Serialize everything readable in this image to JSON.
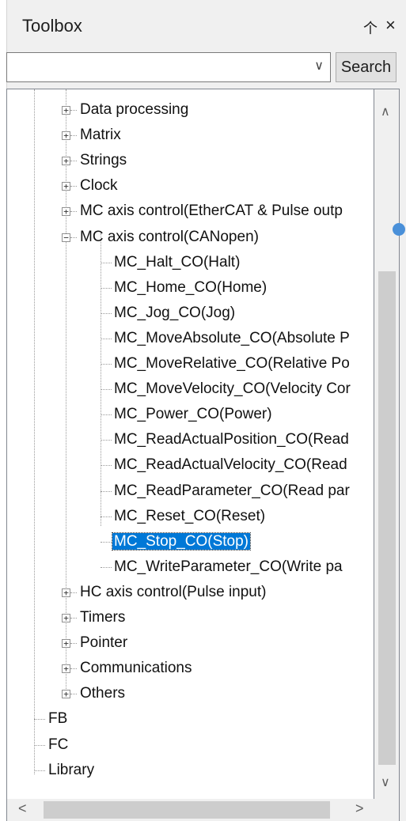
{
  "window": {
    "title": "Toolbox",
    "pin_glyph": "▒",
    "close_glyph": "×"
  },
  "search": {
    "value": "",
    "button_label": "Search"
  },
  "tree": {
    "top_groups": [
      {
        "label": "Data processing"
      },
      {
        "label": "Matrix"
      },
      {
        "label": "Strings"
      },
      {
        "label": "Clock"
      },
      {
        "label": "MC axis control(EtherCAT & Pulse outp"
      },
      {
        "label": "MC axis control(CANopen)"
      }
    ],
    "canopen_children": [
      {
        "label": "MC_Halt_CO(Halt)"
      },
      {
        "label": "MC_Home_CO(Home)"
      },
      {
        "label": "MC_Jog_CO(Jog)"
      },
      {
        "label": "MC_MoveAbsolute_CO(Absolute P"
      },
      {
        "label": "MC_MoveRelative_CO(Relative Po"
      },
      {
        "label": "MC_MoveVelocity_CO(Velocity Cor"
      },
      {
        "label": "MC_Power_CO(Power)"
      },
      {
        "label": "MC_ReadActualPosition_CO(Read"
      },
      {
        "label": "MC_ReadActualVelocity_CO(Read"
      },
      {
        "label": "MC_ReadParameter_CO(Read par"
      },
      {
        "label": "MC_Reset_CO(Reset)"
      },
      {
        "label": "MC_Stop_CO(Stop)",
        "selected": true
      },
      {
        "label": "MC_WriteParameter_CO(Write pa"
      }
    ],
    "bottom_groups": [
      {
        "label": "HC axis control(Pulse input)"
      },
      {
        "label": "Timers"
      },
      {
        "label": "Pointer"
      },
      {
        "label": "Communications"
      },
      {
        "label": "Others"
      }
    ],
    "root_items": [
      {
        "label": "FB"
      },
      {
        "label": "FC"
      },
      {
        "label": "Library"
      }
    ]
  },
  "colors": {
    "selection": "#0078d7",
    "accent_dot": "#4a90d9"
  }
}
